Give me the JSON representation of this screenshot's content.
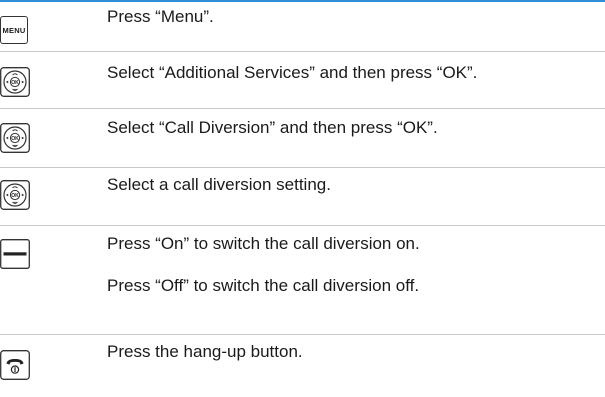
{
  "steps": [
    {
      "icon": "menu-key-icon",
      "key_label": "MENU",
      "lines": [
        "Press “Menu”."
      ]
    },
    {
      "icon": "navigation-ok-key-icon",
      "key_label": "OK",
      "lines": [
        "Select “Additional Services” and then press “OK”."
      ]
    },
    {
      "icon": "navigation-ok-key-icon",
      "key_label": "OK",
      "lines": [
        "Select “Call Diversion” and then press “OK”."
      ]
    },
    {
      "icon": "navigation-ok-key-icon",
      "key_label": "OK",
      "lines": [
        "Select a call diversion setting."
      ]
    },
    {
      "icon": "softkey-icon",
      "lines": [
        "Press “On” to switch the call diversion on.",
        "Press “Off” to switch the call diversion off."
      ]
    },
    {
      "icon": "hang-up-key-icon",
      "lines": [
        "Press the hang-up button."
      ]
    }
  ],
  "colors": {
    "top_rule": "#2f8fd6",
    "separator": "#c8c8c8"
  }
}
